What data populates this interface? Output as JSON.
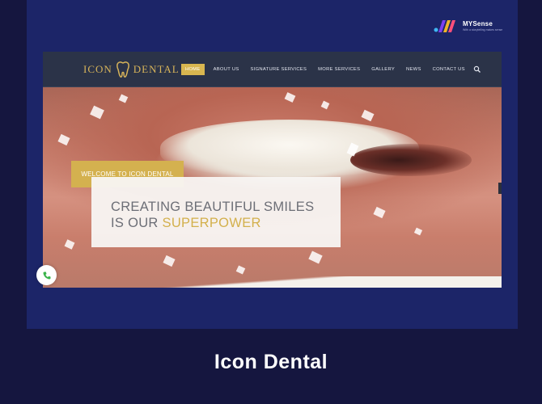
{
  "brand": {
    "name": "MYSense",
    "tagline": "With a storytelling makes sense"
  },
  "site": {
    "logo_left": "ICON",
    "logo_right": "DENTAL",
    "menu": [
      {
        "label": "HOME",
        "active": true
      },
      {
        "label": "ABOUT US"
      },
      {
        "label": "SIGNATURE SERVICES"
      },
      {
        "label": "MORE SERVICES"
      },
      {
        "label": "GALLERY"
      },
      {
        "label": "NEWS"
      },
      {
        "label": "CONTACT US"
      }
    ],
    "hero": {
      "welcome": "WELCOME TO ICON DENTAL",
      "headline_line1": "CREATING BEAUTIFUL SMILES",
      "headline_line2_prefix": "IS OUR ",
      "headline_line2_highlight": "SUPERPOWER"
    }
  },
  "caption": "Icon Dental",
  "colors": {
    "background": "#15163f",
    "panel": "#1c2568",
    "gold": "#d4b14f",
    "nav": "#2b3348"
  },
  "icons": [
    "mysense-logo-icon",
    "tooth-icon",
    "search-icon",
    "phone-icon"
  ]
}
